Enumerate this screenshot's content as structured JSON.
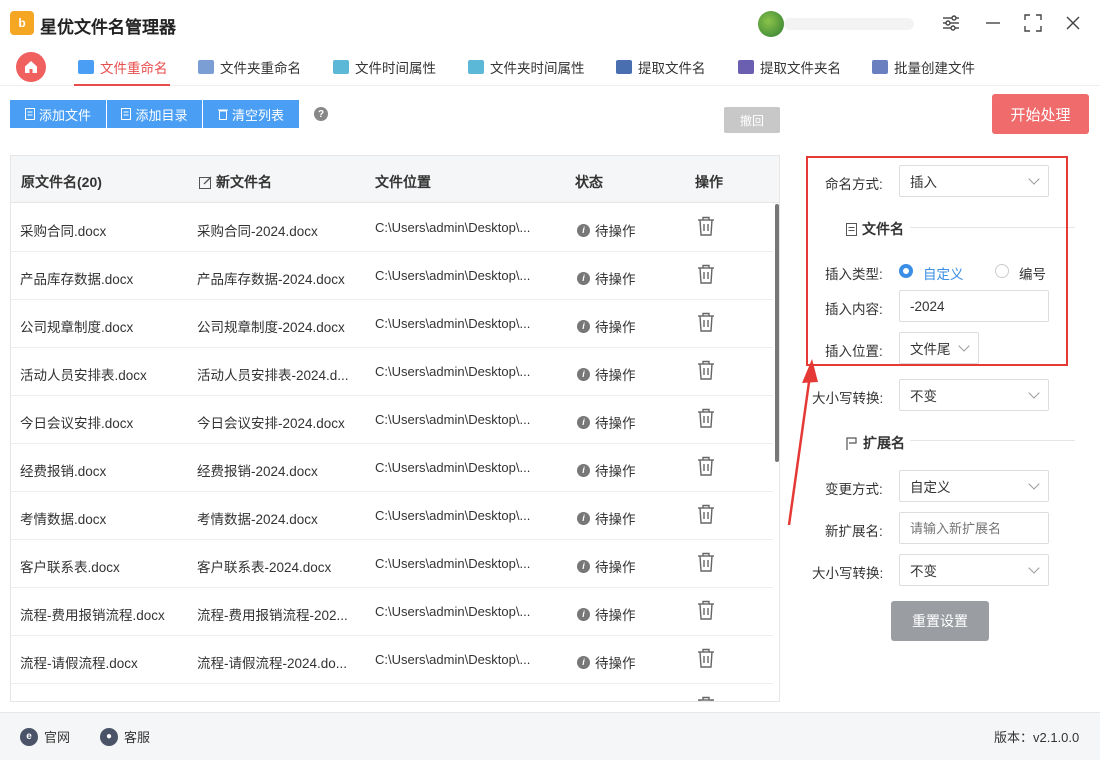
{
  "app": {
    "title": "星优文件名管理器",
    "logo_text": "b"
  },
  "tabs": [
    {
      "label": "文件重命名",
      "icon": "rename-icon",
      "color": "#4a9ff5"
    },
    {
      "label": "文件夹重命名",
      "icon": "folder-rename-icon",
      "color": "#7b9fd4"
    },
    {
      "label": "文件时间属性",
      "icon": "file-time-icon",
      "color": "#5bb8d6"
    },
    {
      "label": "文件夹时间属性",
      "icon": "folder-time-icon",
      "color": "#5bb8d6"
    },
    {
      "label": "提取文件名",
      "icon": "extract-filename-icon",
      "color": "#4a6fb0"
    },
    {
      "label": "提取文件夹名",
      "icon": "extract-foldername-icon",
      "color": "#6a5fb0"
    },
    {
      "label": "批量创建文件",
      "icon": "batch-create-icon",
      "color": "#6a7fc0"
    }
  ],
  "toolbar": {
    "add_file": "添加文件",
    "add_dir": "添加目录",
    "clear_list": "清空列表",
    "help": "?",
    "undo": "撤回",
    "start": "开始处理"
  },
  "table": {
    "headers": {
      "orig": "原文件名(20)",
      "new": "新文件名",
      "path": "文件位置",
      "status": "状态",
      "action": "操作"
    },
    "rows": [
      {
        "orig": "采购合同.docx",
        "new": "采购合同-2024.docx",
        "path": "C:\\Users\\admin\\Desktop\\...",
        "status": "待操作"
      },
      {
        "orig": "产品库存数据.docx",
        "new": "产品库存数据-2024.docx",
        "path": "C:\\Users\\admin\\Desktop\\...",
        "status": "待操作"
      },
      {
        "orig": "公司规章制度.docx",
        "new": "公司规章制度-2024.docx",
        "path": "C:\\Users\\admin\\Desktop\\...",
        "status": "待操作"
      },
      {
        "orig": "活动人员安排表.docx",
        "new": "活动人员安排表-2024.d...",
        "path": "C:\\Users\\admin\\Desktop\\...",
        "status": "待操作"
      },
      {
        "orig": "今日会议安排.docx",
        "new": "今日会议安排-2024.docx",
        "path": "C:\\Users\\admin\\Desktop\\...",
        "status": "待操作"
      },
      {
        "orig": "经费报销.docx",
        "new": "经费报销-2024.docx",
        "path": "C:\\Users\\admin\\Desktop\\...",
        "status": "待操作"
      },
      {
        "orig": "考情数据.docx",
        "new": "考情数据-2024.docx",
        "path": "C:\\Users\\admin\\Desktop\\...",
        "status": "待操作"
      },
      {
        "orig": "客户联系表.docx",
        "new": "客户联系表-2024.docx",
        "path": "C:\\Users\\admin\\Desktop\\...",
        "status": "待操作"
      },
      {
        "orig": "流程-费用报销流程.docx",
        "new": "流程-费用报销流程-202...",
        "path": "C:\\Users\\admin\\Desktop\\...",
        "status": "待操作"
      },
      {
        "orig": "流程-请假流程.docx",
        "new": "流程-请假流程-2024.do...",
        "path": "C:\\Users\\admin\\Desktop\\...",
        "status": "待操作"
      }
    ]
  },
  "panel": {
    "naming_label": "命名方式:",
    "naming_value": "插入",
    "filename_section": "文件名",
    "insert_type_label": "插入类型:",
    "insert_type_custom": "自定义",
    "insert_type_number": "编号",
    "insert_content_label": "插入内容:",
    "insert_content_value": "-2024",
    "insert_pos_label": "插入位置:",
    "insert_pos_value": "文件尾",
    "case_label": "大小写转换:",
    "case_value": "不变",
    "ext_section": "扩展名",
    "change_mode_label": "变更方式:",
    "change_mode_value": "自定义",
    "new_ext_label": "新扩展名:",
    "new_ext_placeholder": "请输入新扩展名",
    "ext_case_label": "大小写转换:",
    "ext_case_value": "不变",
    "reset": "重置设置"
  },
  "footer": {
    "website": "官网",
    "support": "客服",
    "version": "版本：v2.1.0.0"
  },
  "colors": {
    "accent": "#4a9ff5",
    "danger": "#e84d4d",
    "start": "#f06b6b",
    "highlight": "#e53935"
  }
}
